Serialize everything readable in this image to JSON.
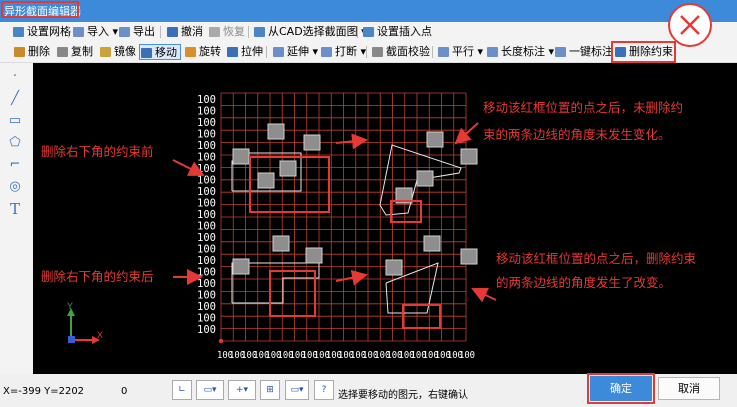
{
  "window": {
    "title": "异形截面编辑器"
  },
  "toolbar1": {
    "items": [
      "设置网格",
      "导入",
      "导出",
      "撤消",
      "恢复",
      "从CAD选择截面图",
      "设置插入点"
    ]
  },
  "toolbar2": {
    "items": [
      "删除",
      "复制",
      "镜像",
      "移动",
      "旋转",
      "拉伸",
      "延伸",
      "打断",
      "截面校验",
      "平行",
      "长度标注",
      "一键标注",
      "删除约束"
    ]
  },
  "sidebar": {
    "tools": [
      "point-tool-icon",
      "line-tool-icon",
      "rect-tool-icon",
      "polygon-tool-icon",
      "polyline-tool-icon",
      "circle-tool-icon",
      "text-tool-icon"
    ],
    "text_tool_glyph": "T"
  },
  "canvas": {
    "grid_labels": [
      "100",
      "100",
      "100",
      "100",
      "100",
      "100",
      "100",
      "100",
      "100",
      "100",
      "100",
      "100",
      "100",
      "100",
      "100",
      "100",
      "100",
      "100",
      "100",
      "100",
      "100"
    ],
    "x_axis_label": "X",
    "y_axis_label": "Y",
    "annotations": {
      "before_left": "删除右下角的约束前",
      "after_left": "删除右下角的约束后",
      "top_right": "移动该红框位置的点之后，未删除约束的两条边线的角度未发生变化。",
      "bottom_right": "移动该红框位置的点之后，删除约束的两条边线的角度发生了改变。"
    }
  },
  "status_bar": {
    "coords": "X=-399 Y=2202",
    "value": "0",
    "hint": "选择要移动的图元，右键确认"
  },
  "buttons": {
    "ok": "确定",
    "cancel": "取消"
  },
  "colors": {
    "title_bar": "#3c8ad9",
    "grid": "#c0402e",
    "annotation": "#e53935",
    "highlight": "#e53935",
    "axis_x": "#e53935",
    "axis_y": "#43a047"
  }
}
